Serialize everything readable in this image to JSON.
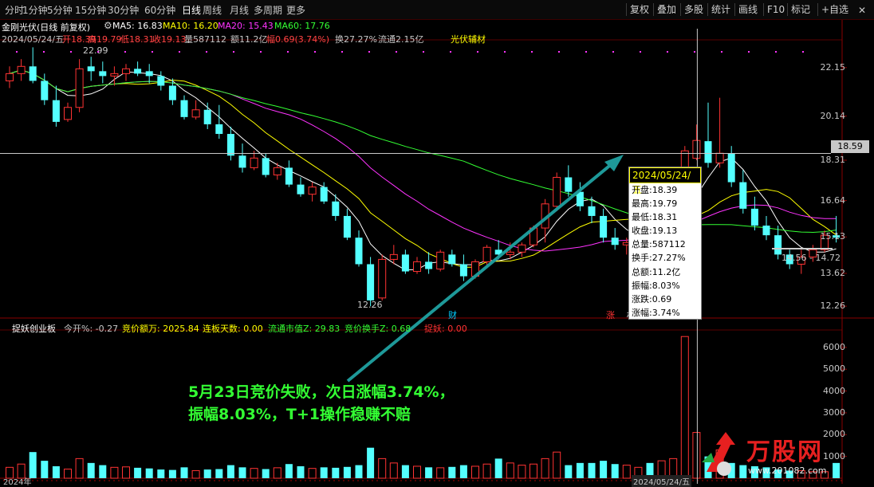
{
  "periods": [
    "分时",
    "1分钟",
    "5分钟",
    "15分钟",
    "30分钟",
    "60分钟",
    "日线",
    "周线",
    "月线",
    "多周期",
    "更多"
  ],
  "active_period": "日线",
  "right_tools": [
    "复权",
    "叠加",
    "多股",
    "统计",
    "画线",
    "F10",
    "标记",
    "+自选"
  ],
  "stock_title": "金刚光伏(日线 前复权)",
  "ma_labels": [
    {
      "text": "MA5: 16.83",
      "color": "#ffffff"
    },
    {
      "text": "MA10: 16.20",
      "color": "#ffff00"
    },
    {
      "text": "MA20: 15.43",
      "color": "#ff33ff"
    },
    {
      "text": "MA60: 17.76",
      "color": "#33ff33"
    }
  ],
  "day_info": [
    {
      "text": "2024/05/24/五",
      "color": "#c8c8c8"
    },
    {
      "text": "开18.39",
      "color": "#ff4444"
    },
    {
      "text": "高19.79",
      "color": "#ff4444"
    },
    {
      "text": "低18.31",
      "color": "#ff4444"
    },
    {
      "text": "收19.13",
      "color": "#ff4444"
    },
    {
      "text": "量587112",
      "color": "#c8c8c8"
    },
    {
      "text": "额11.2亿",
      "color": "#c8c8c8"
    },
    {
      "text": "幅0.69(3.74%)",
      "color": "#ff4444"
    },
    {
      "text": "换27.27%",
      "color": "#c8c8c8"
    },
    {
      "text": "流通2.15亿",
      "color": "#c8c8c8"
    },
    {
      "text": "光伏辅材",
      "color": "#ffff00"
    }
  ],
  "price_axis": [
    "22.15",
    "20.14",
    "18.31",
    "16.64",
    "15.13",
    "13.62",
    "12.26"
  ],
  "current_price": "18.59",
  "high_marker": "22.99",
  "low_marker": "12.26",
  "range_marker": "14.56 - 14.72",
  "event_marks": [
    {
      "text": "财",
      "color": "#00ccff"
    },
    {
      "text": "涨",
      "color": "#ff3333"
    },
    {
      "text": "权",
      "color": "#ffffff"
    }
  ],
  "indicator_title": "捉妖创业板",
  "indicator_items": [
    {
      "text": "今开%: -0.27",
      "color": "#c8c8c8"
    },
    {
      "text": "竞价额万: 2025.84",
      "color": "#ffff00"
    },
    {
      "text": "连板天数: 0.00",
      "color": "#ffff00"
    },
    {
      "text": "流通市值Z: 29.83",
      "color": "#33ff33"
    },
    {
      "text": "竞价换手Z: 0.68",
      "color": "#33ff33"
    },
    {
      "text": "捉妖: 0.00",
      "color": "#ff3333"
    }
  ],
  "volume_axis": [
    "6000",
    "5000",
    "4000",
    "3000",
    "2000",
    "1000"
  ],
  "tooltip": {
    "date": "2024/05/24/五",
    "rows": [
      "开盘:18.39",
      "最高:19.79",
      "最低:18.31",
      "收盘:19.13",
      "总量:587112",
      "换手:27.27%",
      "总额:11.2亿",
      "振幅:8.03%",
      "涨跌:0.69",
      "涨幅:3.74%"
    ]
  },
  "annotation": [
    "5月23日竞价失败，次日涨幅3.74%，",
    "振幅8.03%，T+1操作稳赚不赔"
  ],
  "bottom_dates": [
    "2024年",
    "2024/05/24/五"
  ],
  "logo": {
    "title": "万股网",
    "subtitle": "www.201082.com"
  },
  "chart_data": {
    "type": "candlestick",
    "price_range": [
      12.0,
      23.3
    ],
    "candles": [
      [
        21.6,
        22.2,
        21.3,
        21.9
      ],
      [
        21.9,
        22.5,
        21.6,
        22.2
      ],
      [
        22.2,
        22.99,
        21.5,
        21.6
      ],
      [
        21.6,
        21.9,
        20.6,
        20.8
      ],
      [
        20.8,
        21.4,
        19.7,
        19.9
      ],
      [
        20.0,
        20.7,
        19.9,
        20.5
      ],
      [
        20.5,
        22.5,
        20.3,
        22.1
      ],
      [
        22.2,
        22.6,
        21.6,
        22.0
      ],
      [
        22.0,
        22.4,
        21.5,
        21.8
      ],
      [
        21.8,
        22.2,
        21.4,
        21.9
      ],
      [
        21.9,
        22.3,
        21.6,
        22.1
      ],
      [
        22.1,
        22.4,
        21.8,
        21.9
      ],
      [
        22.0,
        22.3,
        21.5,
        21.8
      ],
      [
        21.8,
        22.0,
        21.2,
        21.4
      ],
      [
        21.4,
        21.7,
        20.6,
        20.8
      ],
      [
        20.8,
        21.0,
        20.0,
        20.1
      ],
      [
        20.1,
        20.8,
        20.0,
        20.4
      ],
      [
        20.4,
        20.7,
        19.6,
        19.8
      ],
      [
        19.8,
        20.6,
        19.2,
        19.4
      ],
      [
        19.4,
        19.7,
        18.3,
        18.5
      ],
      [
        18.5,
        19.0,
        17.8,
        18.0
      ],
      [
        18.0,
        18.7,
        17.9,
        18.4
      ],
      [
        18.4,
        18.6,
        17.6,
        17.7
      ],
      [
        17.7,
        18.2,
        17.5,
        18.0
      ],
      [
        18.0,
        18.3,
        17.2,
        17.3
      ],
      [
        17.3,
        17.6,
        16.8,
        16.9
      ],
      [
        16.9,
        17.4,
        16.6,
        17.2
      ],
      [
        17.2,
        17.4,
        16.5,
        16.6
      ],
      [
        16.6,
        16.9,
        15.8,
        16.0
      ],
      [
        16.0,
        16.3,
        15.0,
        15.1
      ],
      [
        15.1,
        15.4,
        13.9,
        14.0
      ],
      [
        14.0,
        14.3,
        12.26,
        12.5
      ],
      [
        12.6,
        14.4,
        12.5,
        14.2
      ],
      [
        14.2,
        14.8,
        14.0,
        14.4
      ],
      [
        14.4,
        14.6,
        13.6,
        13.7
      ],
      [
        13.7,
        14.3,
        13.6,
        14.1
      ],
      [
        14.1,
        14.5,
        13.6,
        13.8
      ],
      [
        13.8,
        14.6,
        13.7,
        14.5
      ],
      [
        14.4,
        14.6,
        13.9,
        14.0
      ],
      [
        14.0,
        14.4,
        13.3,
        13.5
      ],
      [
        13.5,
        14.2,
        13.4,
        14.1
      ],
      [
        14.1,
        14.8,
        13.9,
        14.7
      ],
      [
        14.6,
        15.0,
        14.2,
        14.4
      ],
      [
        14.4,
        14.9,
        14.2,
        14.5
      ],
      [
        14.5,
        14.9,
        14.3,
        14.8
      ],
      [
        14.8,
        15.6,
        14.7,
        15.5
      ],
      [
        15.5,
        16.7,
        14.9,
        16.5
      ],
      [
        16.4,
        17.8,
        16.2,
        17.6
      ],
      [
        17.6,
        18.1,
        16.8,
        17.0
      ],
      [
        17.0,
        17.4,
        16.2,
        16.4
      ],
      [
        16.4,
        16.8,
        15.7,
        16.0
      ],
      [
        16.0,
        16.3,
        14.9,
        15.1
      ],
      [
        15.1,
        15.5,
        14.6,
        14.8
      ],
      [
        14.8,
        15.1,
        14.4,
        14.9
      ],
      [
        14.9,
        15.3,
        14.6,
        15.0
      ],
      [
        15.0,
        15.3,
        14.3,
        14.5
      ],
      [
        14.5,
        15.4,
        14.3,
        15.3
      ],
      [
        15.3,
        16.8,
        15.1,
        16.6
      ],
      [
        16.5,
        18.9,
        16.4,
        18.7
      ],
      [
        18.39,
        19.79,
        18.31,
        19.13
      ],
      [
        19.1,
        20.7,
        18.0,
        18.2
      ],
      [
        18.2,
        20.9,
        18.0,
        18.6
      ],
      [
        18.6,
        18.9,
        17.2,
        17.4
      ],
      [
        17.4,
        17.9,
        16.1,
        16.3
      ],
      [
        16.3,
        16.8,
        15.4,
        15.6
      ],
      [
        15.6,
        16.0,
        15.0,
        15.2
      ],
      [
        15.2,
        15.6,
        14.2,
        14.4
      ],
      [
        14.4,
        14.6,
        13.8,
        14.0
      ],
      [
        14.0,
        14.6,
        13.6,
        14.3
      ],
      [
        14.3,
        14.8,
        14.1,
        14.6
      ],
      [
        14.6,
        15.4,
        14.5,
        15.2
      ],
      [
        15.2,
        16.0,
        14.9,
        15.1
      ]
    ],
    "volume": [
      500,
      650,
      1200,
      800,
      550,
      420,
      900,
      700,
      600,
      500,
      520,
      480,
      450,
      400,
      380,
      500,
      350,
      400,
      420,
      600,
      500,
      450,
      420,
      480,
      650,
      550,
      450,
      500,
      480,
      520,
      600,
      1400,
      900,
      700,
      600,
      550,
      500,
      480,
      520,
      600,
      550,
      650,
      900,
      700,
      600,
      650,
      900,
      1200,
      600,
      700,
      700,
      800,
      650,
      600,
      500,
      700,
      800,
      900,
      6500,
      2100,
      1000,
      1300,
      700,
      600,
      550,
      500,
      400,
      350,
      350,
      300,
      300,
      700
    ]
  }
}
